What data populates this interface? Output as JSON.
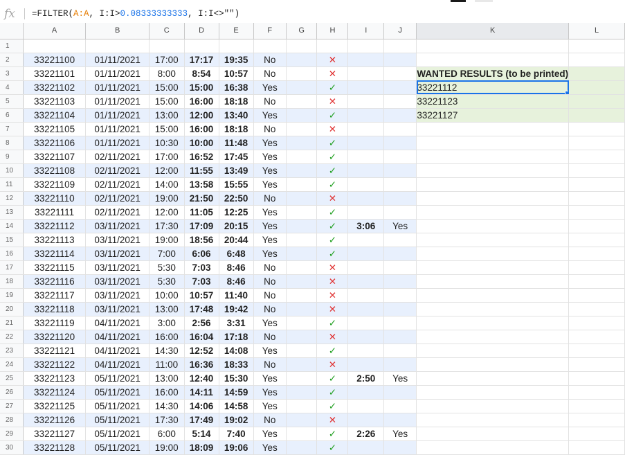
{
  "formula_bar": {
    "fx_label": "fx",
    "formula_prefix": "=FILTER(",
    "formula_ref1": "A:A",
    "formula_mid": ", I:I>",
    "formula_num": "0.08333333333",
    "formula_mid2": ", I:I<>\"\")"
  },
  "columns": [
    "A",
    "B",
    "C",
    "D",
    "E",
    "F",
    "G",
    "H",
    "I",
    "J",
    "K",
    "L"
  ],
  "rows": [
    {
      "n": "1",
      "id": "",
      "date": "",
      "c": "",
      "d": "",
      "e": "",
      "f": "",
      "h": "",
      "i": "",
      "j": ""
    },
    {
      "n": "2",
      "id": "33221100",
      "date": "01/11/2021",
      "c": "17:00",
      "d": "17:17",
      "e": "19:35",
      "f": "No",
      "h": "x",
      "i": "",
      "j": ""
    },
    {
      "n": "3",
      "id": "33221101",
      "date": "01/11/2021",
      "c": "8:00",
      "d": "8:54",
      "e": "10:57",
      "f": "No",
      "h": "x",
      "i": "",
      "j": ""
    },
    {
      "n": "4",
      "id": "33221102",
      "date": "01/11/2021",
      "c": "15:00",
      "d": "15:00",
      "e": "16:38",
      "f": "Yes",
      "h": "ok",
      "i": "",
      "j": ""
    },
    {
      "n": "5",
      "id": "33221103",
      "date": "01/11/2021",
      "c": "15:00",
      "d": "16:00",
      "e": "18:18",
      "f": "No",
      "h": "x",
      "i": "",
      "j": ""
    },
    {
      "n": "6",
      "id": "33221104",
      "date": "01/11/2021",
      "c": "13:00",
      "d": "12:00",
      "e": "13:40",
      "f": "Yes",
      "h": "ok",
      "i": "",
      "j": ""
    },
    {
      "n": "7",
      "id": "33221105",
      "date": "01/11/2021",
      "c": "15:00",
      "d": "16:00",
      "e": "18:18",
      "f": "No",
      "h": "x",
      "i": "",
      "j": ""
    },
    {
      "n": "8",
      "id": "33221106",
      "date": "01/11/2021",
      "c": "10:30",
      "d": "10:00",
      "e": "11:48",
      "f": "Yes",
      "h": "ok",
      "i": "",
      "j": ""
    },
    {
      "n": "9",
      "id": "33221107",
      "date": "02/11/2021",
      "c": "17:00",
      "d": "16:52",
      "e": "17:45",
      "f": "Yes",
      "h": "ok",
      "i": "",
      "j": ""
    },
    {
      "n": "10",
      "id": "33221108",
      "date": "02/11/2021",
      "c": "12:00",
      "d": "11:55",
      "e": "13:49",
      "f": "Yes",
      "h": "ok",
      "i": "",
      "j": ""
    },
    {
      "n": "11",
      "id": "33221109",
      "date": "02/11/2021",
      "c": "14:00",
      "d": "13:58",
      "e": "15:55",
      "f": "Yes",
      "h": "ok",
      "i": "",
      "j": ""
    },
    {
      "n": "12",
      "id": "33221110",
      "date": "02/11/2021",
      "c": "19:00",
      "d": "21:50",
      "e": "22:50",
      "f": "No",
      "h": "x",
      "i": "",
      "j": ""
    },
    {
      "n": "13",
      "id": "33221111",
      "date": "02/11/2021",
      "c": "12:00",
      "d": "11:05",
      "e": "12:25",
      "f": "Yes",
      "h": "ok",
      "i": "",
      "j": ""
    },
    {
      "n": "14",
      "id": "33221112",
      "date": "03/11/2021",
      "c": "17:30",
      "d": "17:09",
      "e": "20:15",
      "f": "Yes",
      "h": "ok",
      "i": "3:06",
      "j": "Yes"
    },
    {
      "n": "15",
      "id": "33221113",
      "date": "03/11/2021",
      "c": "19:00",
      "d": "18:56",
      "e": "20:44",
      "f": "Yes",
      "h": "ok",
      "i": "",
      "j": ""
    },
    {
      "n": "16",
      "id": "33221114",
      "date": "03/11/2021",
      "c": "7:00",
      "d": "6:06",
      "e": "6:48",
      "f": "Yes",
      "h": "ok",
      "i": "",
      "j": ""
    },
    {
      "n": "17",
      "id": "33221115",
      "date": "03/11/2021",
      "c": "5:30",
      "d": "7:03",
      "e": "8:46",
      "f": "No",
      "h": "x",
      "i": "",
      "j": ""
    },
    {
      "n": "18",
      "id": "33221116",
      "date": "03/11/2021",
      "c": "5:30",
      "d": "7:03",
      "e": "8:46",
      "f": "No",
      "h": "x",
      "i": "",
      "j": ""
    },
    {
      "n": "19",
      "id": "33221117",
      "date": "03/11/2021",
      "c": "10:00",
      "d": "10:57",
      "e": "11:40",
      "f": "No",
      "h": "x",
      "i": "",
      "j": ""
    },
    {
      "n": "20",
      "id": "33221118",
      "date": "03/11/2021",
      "c": "13:00",
      "d": "17:48",
      "e": "19:42",
      "f": "No",
      "h": "x",
      "i": "",
      "j": ""
    },
    {
      "n": "21",
      "id": "33221119",
      "date": "04/11/2021",
      "c": "3:00",
      "d": "2:56",
      "e": "3:31",
      "f": "Yes",
      "h": "ok",
      "i": "",
      "j": ""
    },
    {
      "n": "22",
      "id": "33221120",
      "date": "04/11/2021",
      "c": "16:00",
      "d": "16:04",
      "e": "17:18",
      "f": "No",
      "h": "x",
      "i": "",
      "j": ""
    },
    {
      "n": "23",
      "id": "33221121",
      "date": "04/11/2021",
      "c": "14:30",
      "d": "12:52",
      "e": "14:08",
      "f": "Yes",
      "h": "ok",
      "i": "",
      "j": ""
    },
    {
      "n": "24",
      "id": "33221122",
      "date": "04/11/2021",
      "c": "11:00",
      "d": "16:36",
      "e": "18:33",
      "f": "No",
      "h": "x",
      "i": "",
      "j": ""
    },
    {
      "n": "25",
      "id": "33221123",
      "date": "05/11/2021",
      "c": "13:00",
      "d": "12:40",
      "e": "15:30",
      "f": "Yes",
      "h": "ok",
      "i": "2:50",
      "j": "Yes"
    },
    {
      "n": "26",
      "id": "33221124",
      "date": "05/11/2021",
      "c": "16:00",
      "d": "14:11",
      "e": "14:59",
      "f": "Yes",
      "h": "ok",
      "i": "",
      "j": ""
    },
    {
      "n": "27",
      "id": "33221125",
      "date": "05/11/2021",
      "c": "14:30",
      "d": "14:06",
      "e": "14:58",
      "f": "Yes",
      "h": "ok",
      "i": "",
      "j": ""
    },
    {
      "n": "28",
      "id": "33221126",
      "date": "05/11/2021",
      "c": "17:30",
      "d": "17:49",
      "e": "19:02",
      "f": "No",
      "h": "x",
      "i": "",
      "j": ""
    },
    {
      "n": "29",
      "id": "33221127",
      "date": "05/11/2021",
      "c": "6:00",
      "d": "5:14",
      "e": "7:40",
      "f": "Yes",
      "h": "ok",
      "i": "2:26",
      "j": "Yes"
    },
    {
      "n": "30",
      "id": "33221128",
      "date": "05/11/2021",
      "c": "19:00",
      "d": "18:09",
      "e": "19:06",
      "f": "Yes",
      "h": "ok",
      "i": "",
      "j": ""
    }
  ],
  "marks": {
    "x": "✕",
    "ok": "✓"
  },
  "results": {
    "header": "WANTED RESULTS (to be printed)",
    "values": [
      "33221112",
      "33221123",
      "33221127"
    ]
  },
  "colors": {
    "band": "#e8f0fd",
    "results_fill": "#e7f2dc",
    "selection": "#1a73e8",
    "ok": "#1e9e1e",
    "x": "#e03131"
  }
}
